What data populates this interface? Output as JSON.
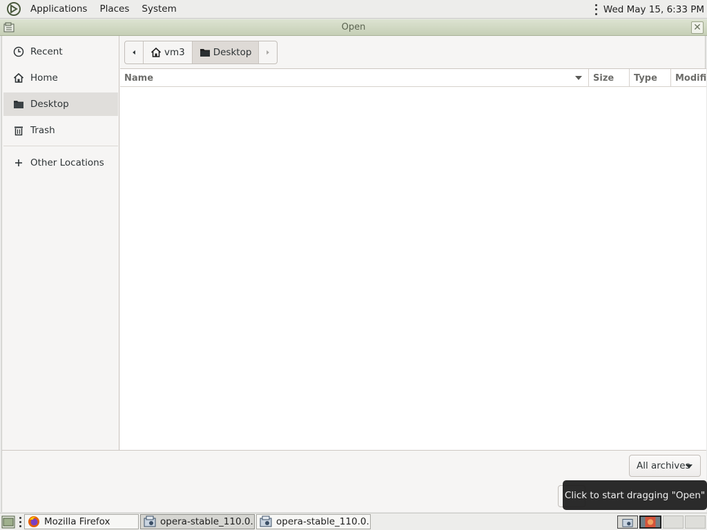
{
  "top_panel": {
    "menus": [
      "Applications",
      "Places",
      "System"
    ],
    "datetime": "Wed May 15,  6:33 PM"
  },
  "window": {
    "title": "Open"
  },
  "sidebar": {
    "items": [
      {
        "label": "Recent",
        "icon": "clock-icon"
      },
      {
        "label": "Home",
        "icon": "home-icon"
      },
      {
        "label": "Desktop",
        "icon": "folder-icon",
        "active": true
      },
      {
        "label": "Trash",
        "icon": "trash-icon"
      },
      {
        "label": "Other Locations",
        "icon": "plus-icon"
      }
    ]
  },
  "path_bar": {
    "segments": [
      "vm3",
      "Desktop"
    ]
  },
  "file_list": {
    "columns": [
      "Name",
      "Size",
      "Type",
      "Modified"
    ],
    "sort_column": "Name",
    "rows": []
  },
  "filter": {
    "label": "All archives"
  },
  "tooltip": {
    "text": "Click to start dragging \"Open\""
  },
  "taskbar": {
    "items": [
      {
        "label": "Mozilla Firefox",
        "icon": "firefox-icon"
      },
      {
        "label": "opera-stable_110.0....",
        "icon": "package-icon",
        "pressed": true
      },
      {
        "label": "opera-stable_110.0....",
        "icon": "package-icon"
      }
    ]
  }
}
